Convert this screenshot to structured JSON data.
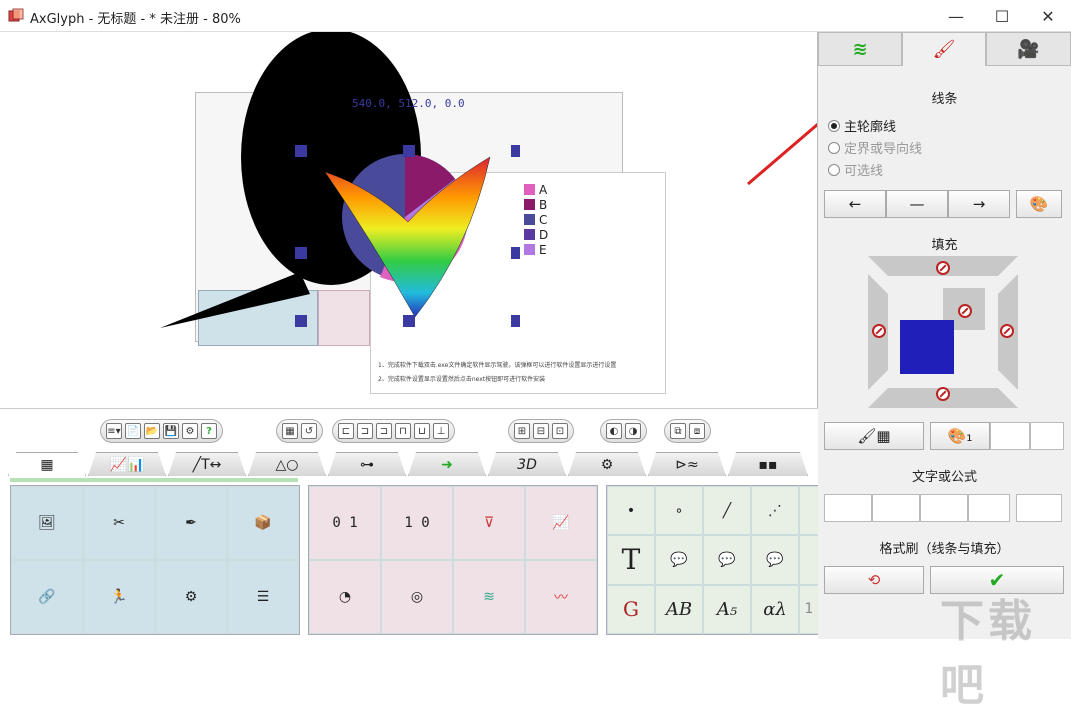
{
  "window": {
    "title": "AxGlyph - 无标题 - * 未注册 - 80%",
    "minimize": "—",
    "maximize": "☐",
    "close": "✕"
  },
  "canvas": {
    "coords": "540.0, 512.0, 0.0",
    "legend": [
      "A",
      "B",
      "C",
      "D",
      "E"
    ],
    "legend_colors": [
      "#e060c0",
      "#8b1a6b",
      "#4a4a9a",
      "#5a3aa0",
      "#b078e0"
    ],
    "doc_lines": [
      "1、完成软件下载双击.exe文件确定软件显示驾驶。该弹框可以进行软件设置显示进行设置",
      "2、完成软件设置显示设置然后点击next按钮即可进行软件安装"
    ]
  },
  "toolbar": {
    "groups": [
      [
        "≡▾",
        "📄",
        "📂",
        "💾",
        "⚙",
        "?"
      ],
      [
        "▦",
        "↺"
      ],
      [
        "⊏",
        "⊐",
        "⊐",
        "⊓",
        "⊔",
        "⊥"
      ],
      [
        "⊞",
        "⊟",
        "⊡"
      ],
      [
        "◐",
        "◑"
      ],
      [
        "⧉",
        "⧈"
      ]
    ]
  },
  "tabs": [
    "▦",
    "📈📊",
    "╱T↔",
    "△○",
    "⊶",
    "➜",
    "3D",
    "⚙",
    "⊳≈",
    "▪▪"
  ],
  "panels": {
    "a": [
      "🖼",
      "✂",
      "✒",
      "📦",
      "🔗",
      "🏃",
      "⚙",
      "☰"
    ],
    "b": [
      "0 1",
      "1 0",
      "⊽",
      "📈",
      "◔",
      "◎",
      "≋",
      "〰"
    ],
    "c": [
      "•",
      "∘",
      "╱",
      "⋰",
      "",
      "T",
      "💬",
      "💬",
      "💬",
      "",
      "G",
      "AB",
      "A₅",
      "αλ",
      "1"
    ]
  },
  "right_panel": {
    "tabs": [
      "≋",
      "🖌",
      "🎥"
    ],
    "section_line": "线条",
    "radios": [
      "主轮廓线",
      "定界或导向线",
      "可选线"
    ],
    "selected_radio": 0,
    "line_buttons": [
      "←",
      "—",
      "→",
      "🎨"
    ],
    "section_fill": "填充",
    "fill_color": "#2020b8",
    "brush_buttons": [
      "🖌▦",
      "🎨₁"
    ],
    "section_text": "文字或公式",
    "section_format": "格式刷（线条与填充）",
    "format_buttons": [
      "⟲",
      "✔"
    ]
  },
  "watermark": "下载吧"
}
